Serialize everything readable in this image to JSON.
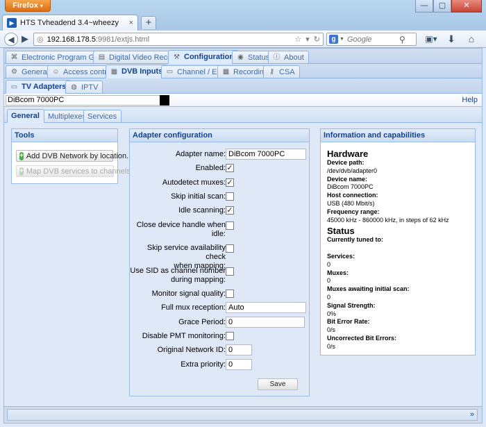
{
  "browser": {
    "menu_label": "Firefox",
    "menu_arrow": "▾",
    "tab_title": "HTS Tvheadend 3.4~wheezy",
    "tab_close": "×",
    "newtab": "+",
    "url_host": "192.168.178.5",
    "url_rest": ":9981/extjs.html",
    "search_placeholder": "Google",
    "window_buttons": [
      "—",
      "▢",
      "✕"
    ]
  },
  "nav": {
    "main_tabs": [
      {
        "label": "Electronic Program Guide",
        "icon": "tag-icon"
      },
      {
        "label": "Digital Video Recorder",
        "icon": "video-icon"
      },
      {
        "label": "Configuration",
        "icon": "wrench-icon",
        "active": true
      },
      {
        "label": "Status",
        "icon": "eye-icon"
      },
      {
        "label": "About",
        "icon": "info-icon"
      }
    ],
    "config_tabs": [
      {
        "label": "General",
        "icon": "gear-icon"
      },
      {
        "label": "Access control",
        "icon": "users-icon"
      },
      {
        "label": "DVB Inputs",
        "icon": "film-icon",
        "active": true
      },
      {
        "label": "Channel / EPG",
        "icon": "tv-icon"
      },
      {
        "label": "Recording",
        "icon": "film-icon"
      },
      {
        "label": "CSA",
        "icon": "key-icon"
      }
    ],
    "input_tabs": [
      {
        "label": "TV Adapters",
        "icon": "tv-icon",
        "active": true
      },
      {
        "label": "IPTV",
        "icon": "globe-icon"
      }
    ],
    "adapter_selected": "DiBcom 7000PC",
    "help": "Help",
    "adapter_tabs": [
      {
        "label": "General",
        "active": true
      },
      {
        "label": "Multiplexes"
      },
      {
        "label": "Services"
      }
    ]
  },
  "tools": {
    "title": "Tools",
    "add_network": "Add DVB Network by location...",
    "map_services": "Map DVB services to channels..."
  },
  "config": {
    "title": "Adapter configuration",
    "adapter_name_label": "Adapter name:",
    "adapter_name_value": "DiBcom 7000PC",
    "enabled_label": "Enabled:",
    "enabled": true,
    "autodetect_label": "Autodetect muxes:",
    "autodetect": true,
    "skip_scan_label": "Skip initial scan:",
    "skip_scan": false,
    "idle_scan_label": "Idle scanning:",
    "idle_scan": true,
    "close_handle_label_1": "Close device handle when",
    "close_handle_label_2": "idle:",
    "close_handle": false,
    "skip_service_label_1": "Skip service availability check",
    "skip_service_label_2": "when mapping:",
    "skip_service": false,
    "use_sid_label_1": "Use SID as channel number",
    "use_sid_label_2": "during mapping:",
    "use_sid": false,
    "monitor_label": "Monitor signal quality:",
    "monitor": false,
    "full_mux_label": "Full mux reception:",
    "full_mux_value": "Auto",
    "grace_label": "Grace Period:",
    "grace_value": "0",
    "disable_pmt_label": "Disable PMT monitoring:",
    "disable_pmt": false,
    "onid_label": "Original Network ID:",
    "onid_value": "0",
    "extra_label": "Extra priority:",
    "extra_value": "0",
    "save": "Save"
  },
  "info": {
    "title": "Information and capabilities",
    "hardware": "Hardware",
    "device_path_label": "Device path:",
    "device_path": "/dev/dvb/adapter0",
    "device_name_label": "Device name:",
    "device_name": "DiBcom 7000PC",
    "host_conn_label": "Host connection:",
    "host_conn": "USB (480 Mbit/s)",
    "freq_label": "Frequency range:",
    "freq": "45000 kHz - 860000 kHz, in steps of 62 kHz",
    "status": "Status",
    "tuned_label": "Currently tuned to:",
    "tuned": "",
    "services_label": "Services:",
    "services": "0",
    "muxes_label": "Muxes:",
    "muxes": "0",
    "muxes_await_label": "Muxes awaiting initial scan:",
    "muxes_await": "0",
    "signal_label": "Signal Strength:",
    "signal": "0%",
    "ber_label": "Bit Error Rate:",
    "ber": "0/s",
    "unc_label": "Uncorrected Bit Errors:",
    "unc": "0/s"
  },
  "statusbar": {
    "chevron": "»"
  }
}
